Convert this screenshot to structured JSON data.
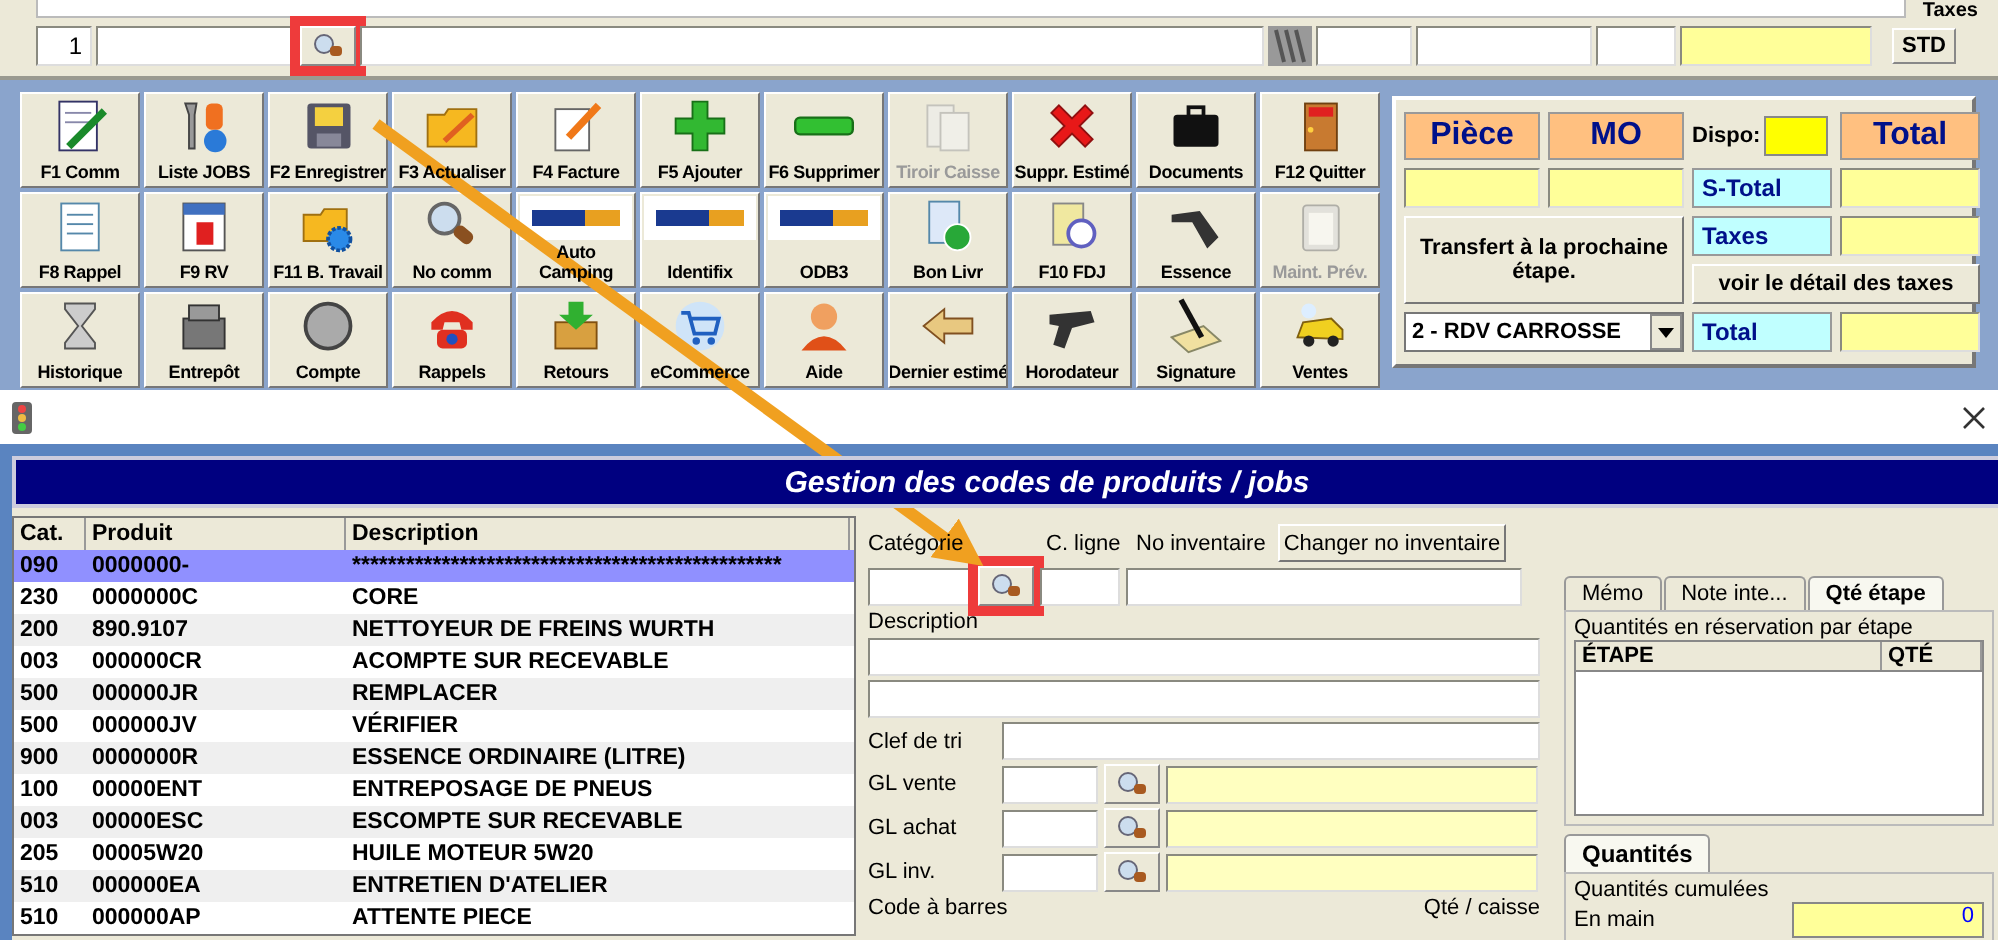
{
  "top_bar": {
    "taxes_label": "Taxes",
    "line_number": "1",
    "lookup": {
      "highlighted": true
    },
    "std_button": "STD"
  },
  "toolbar": [
    {
      "label": "F1 Comm",
      "kind": "icon",
      "disabled": false
    },
    {
      "label": "Liste JOBS",
      "kind": "icon",
      "disabled": false
    },
    {
      "label": "F2 Enregistrer",
      "kind": "icon",
      "disabled": false
    },
    {
      "label": "F3 Actualiser",
      "kind": "icon",
      "disabled": false
    },
    {
      "label": "F4  Facture",
      "kind": "icon",
      "disabled": false
    },
    {
      "label": "F5 Ajouter",
      "kind": "icon",
      "disabled": false
    },
    {
      "label": "F6 Supprimer",
      "kind": "icon",
      "disabled": false
    },
    {
      "label": "Tiroir Caisse",
      "kind": "icon",
      "disabled": true
    },
    {
      "label": "Suppr. Estimé",
      "kind": "icon",
      "disabled": false
    },
    {
      "label": "Documents",
      "kind": "icon",
      "disabled": false
    },
    {
      "label": "F12 Quitter",
      "kind": "icon",
      "disabled": false
    },
    {
      "label": "F8 Rappel",
      "kind": "icon",
      "disabled": false
    },
    {
      "label": "F9 RV",
      "kind": "icon",
      "disabled": false
    },
    {
      "label": "F11 B. Travail",
      "kind": "icon",
      "disabled": false
    },
    {
      "label": "No comm",
      "kind": "icon",
      "disabled": false
    },
    {
      "label": "Auto Camping",
      "kind": "logo",
      "disabled": false
    },
    {
      "label": "Identifix",
      "kind": "logo",
      "disabled": false
    },
    {
      "label": "ODB3",
      "kind": "logo",
      "disabled": false
    },
    {
      "label": "Bon Livr",
      "kind": "icon",
      "disabled": false
    },
    {
      "label": "F10  FDJ",
      "kind": "icon",
      "disabled": false
    },
    {
      "label": "Essence",
      "kind": "icon",
      "disabled": false
    },
    {
      "label": "Maint. Prév.",
      "kind": "icon",
      "disabled": true
    },
    {
      "label": "Historique",
      "kind": "icon",
      "disabled": false
    },
    {
      "label": "Entrepôt",
      "kind": "icon",
      "disabled": false
    },
    {
      "label": "Compte",
      "kind": "icon",
      "disabled": false
    },
    {
      "label": "Rappels",
      "kind": "icon",
      "disabled": false
    },
    {
      "label": "Retours",
      "kind": "icon",
      "disabled": false
    },
    {
      "label": "eCommerce",
      "kind": "icon",
      "disabled": false
    },
    {
      "label": "Aide",
      "kind": "icon",
      "disabled": false
    },
    {
      "label": "Dernier estimé",
      "kind": "icon",
      "disabled": false
    },
    {
      "label": "Horodateur",
      "kind": "icon",
      "disabled": false
    },
    {
      "label": "Signature",
      "kind": "icon",
      "disabled": false
    },
    {
      "label": "Ventes",
      "kind": "icon",
      "disabled": false
    }
  ],
  "totals_panel": {
    "piece_header": "Pièce",
    "mo_header": "MO",
    "dispo_label": "Dispo:",
    "total_header": "Total",
    "s_total_label": "S-Total",
    "taxes_label": "Taxes",
    "transfer_button": "Transfert à la prochaine étape.",
    "tax_detail_button": "voir le détail des taxes",
    "stage_select": "2 - RDV CARROSSE",
    "total_label": "Total"
  },
  "window": {
    "title": "Gestion des codes de produits / jobs"
  },
  "product_list": {
    "columns": [
      "Cat.",
      "Produit",
      "Description"
    ],
    "rows": [
      {
        "cells": [
          "090",
          "0000000-",
          "************************************************"
        ],
        "selected": true
      },
      {
        "cells": [
          "230",
          "0000000C",
          "CORE"
        ],
        "selected": false
      },
      {
        "cells": [
          "200",
          "890.9107",
          "NETTOYEUR DE FREINS WURTH"
        ],
        "selected": false
      },
      {
        "cells": [
          "003",
          "000000CR",
          "ACOMPTE SUR RECEVABLE"
        ],
        "selected": false
      },
      {
        "cells": [
          "500",
          "000000JR",
          "REMPLACER"
        ],
        "selected": false
      },
      {
        "cells": [
          "500",
          "000000JV",
          "VÉRIFIER"
        ],
        "selected": false
      },
      {
        "cells": [
          "900",
          "0000000R",
          "ESSENCE ORDINAIRE (LITRE)"
        ],
        "selected": false
      },
      {
        "cells": [
          "100",
          "00000ENT",
          "ENTREPOSAGE DE PNEUS"
        ],
        "selected": false
      },
      {
        "cells": [
          "003",
          "00000ESC",
          "ESCOMPTE SUR RECEVABLE"
        ],
        "selected": false
      },
      {
        "cells": [
          "205",
          "00005W20",
          "HUILE MOTEUR 5W20"
        ],
        "selected": false
      },
      {
        "cells": [
          "510",
          "000000EA",
          "ENTRETIEN D'ATELIER"
        ],
        "selected": false
      },
      {
        "cells": [
          "510",
          "000000AP",
          "ATTENTE PIECE"
        ],
        "selected": false
      }
    ]
  },
  "form": {
    "category_label": "Catégorie",
    "line_code_label": "C. ligne",
    "inventory_label": "No inventaire",
    "change_inventory_button": "Changer no inventaire",
    "category_lookup": {
      "highlighted": true
    },
    "description_label": "Description",
    "sort_key_label": "Clef de tri",
    "gl_rows": [
      {
        "label": "GL vente",
        "lookup": {
          "highlighted": false
        }
      },
      {
        "label": "GL achat",
        "lookup": {
          "highlighted": false
        }
      },
      {
        "label": "GL inv.",
        "lookup": {
          "highlighted": false
        }
      }
    ],
    "barcode_label": "Code à barres",
    "qty_per_case_label": "Qté / caisse"
  },
  "side_tabs": [
    {
      "label": "Mémo",
      "selected": false
    },
    {
      "label": "Note inte...",
      "selected": false
    },
    {
      "label": "Qté étape",
      "selected": true
    }
  ],
  "reservation_group": {
    "title": "Quantités en réservation par étape",
    "columns": [
      "ÉTAPE",
      "QTÉ"
    ]
  },
  "quantity_tabs": [
    {
      "label": "Quantités",
      "selected": true
    }
  ],
  "cumulative_group": {
    "title": "Quantités cumulées",
    "on_hand_label": "En main",
    "on_hand_value": "0"
  }
}
